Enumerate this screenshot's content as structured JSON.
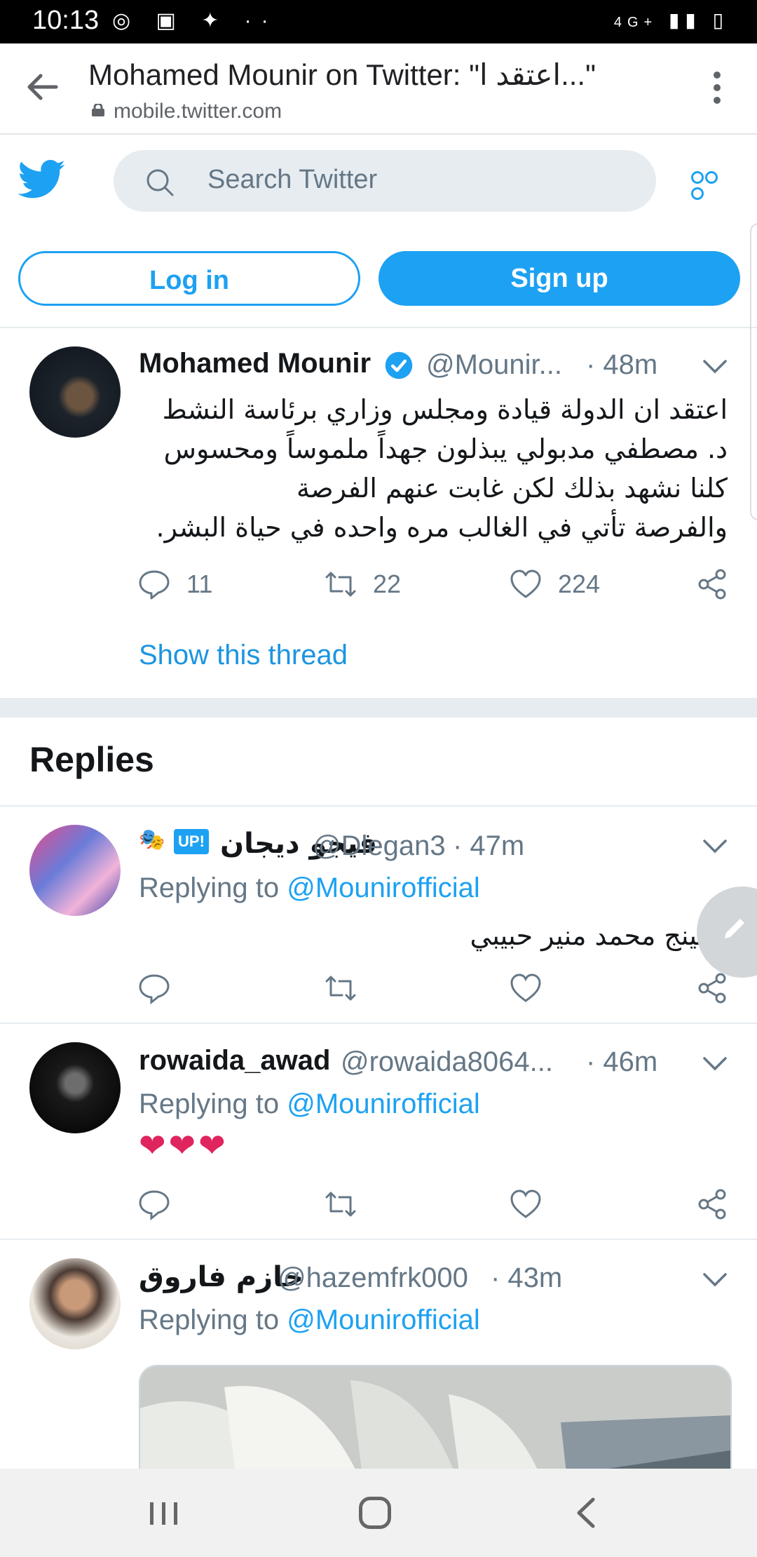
{
  "status_bar": {
    "time": "10:13",
    "network": "4G+"
  },
  "browser": {
    "title": "Mohamed Mounir on Twitter: \"اعتقد ا...\"",
    "url": "mobile.twitter.com"
  },
  "header": {
    "search_placeholder": "Search Twitter",
    "login_label": "Log in",
    "signup_label": "Sign up"
  },
  "main_tweet": {
    "name": "Mohamed Mounir",
    "handle": "@Mounir...",
    "time": "· 48m",
    "lines": [
      "اعتقد ان الدولة قيادة ومجلس وزاري برئاسة النشط",
      "د. مصطفي مدبولي يبذلون جهداً ملموساً ومحسوس",
      "كلنا نشهد بذلك لكن غابت عنهم الفرصة",
      "والفرصة تأتي في الغالب مره واحده في حياة البشر."
    ],
    "replies": "11",
    "retweets": "22",
    "likes": "224",
    "show_thread": "Show this thread"
  },
  "replies_heading": "Replies",
  "replies": [
    {
      "name": "فيجو ديجان",
      "handle": "@Dlegan3",
      "time": "· 47m",
      "badge": "UP!",
      "replying_prefix": "Replying to",
      "replying_to": "@Mounirofficial",
      "text": "الكينج محمد منير حبيبي"
    },
    {
      "name": "rowaida_awad",
      "handle": "@rowaida8064...",
      "time": "· 46m",
      "replying_prefix": "Replying to",
      "replying_to": "@Mounirofficial",
      "text": "❤❤❤"
    },
    {
      "name": "حازم فاروق",
      "handle": "@hazemfrk000",
      "time": "· 43m",
      "replying_prefix": "Replying to",
      "replying_to": "@Mounirofficial"
    }
  ],
  "colors": {
    "accent": "#1da1f2",
    "muted": "#657786",
    "heart": "#e0245e"
  },
  "icons": [
    "back-arrow-icon",
    "lock-icon",
    "overflow-menu-icon",
    "twitter-bird-icon",
    "search-icon",
    "more-icon",
    "verified-badge-icon",
    "chevron-down-icon",
    "reply-icon",
    "retweet-icon",
    "like-icon",
    "share-icon",
    "compose-icon"
  ]
}
